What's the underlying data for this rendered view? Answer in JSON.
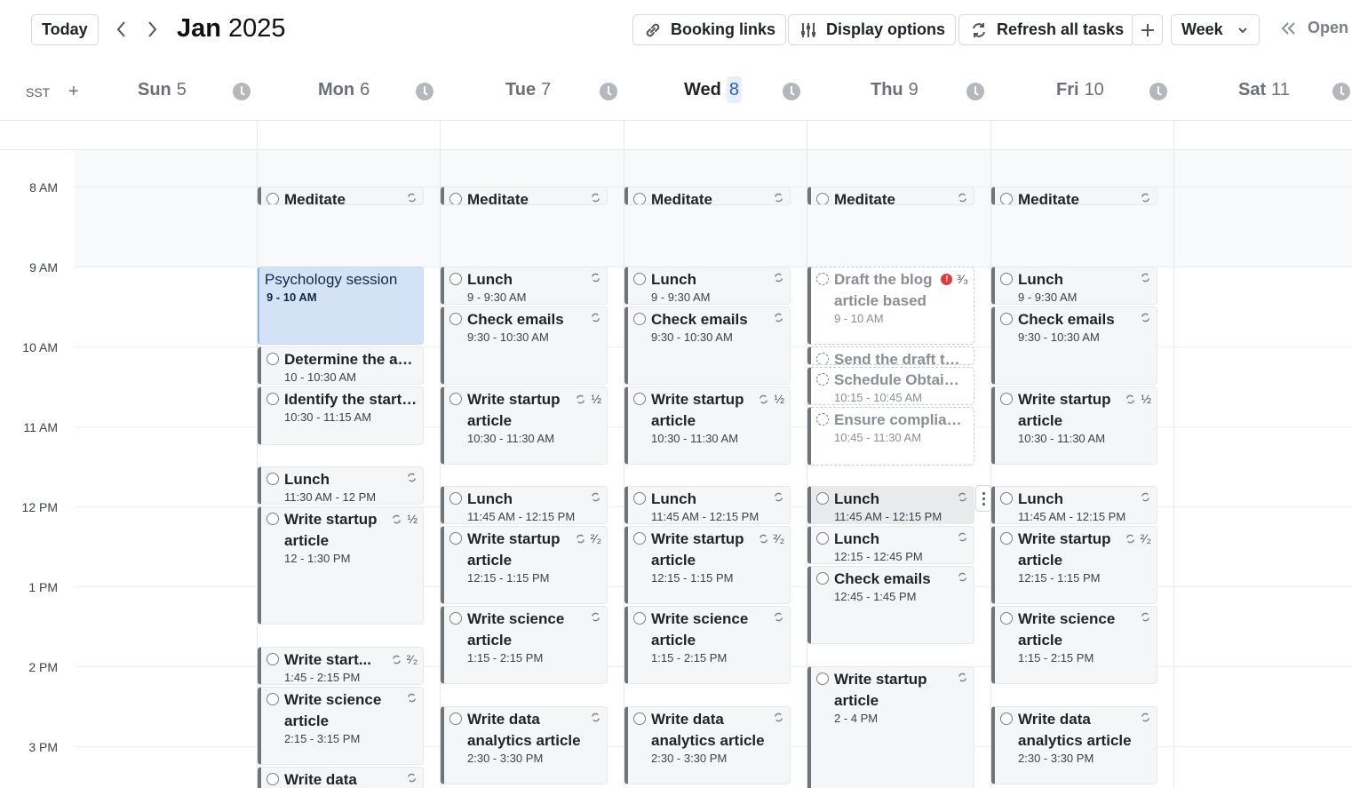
{
  "toolbar": {
    "today": "Today",
    "month": "Jan",
    "year": "2025",
    "booking_links": "Booking links",
    "display_options": "Display options",
    "refresh": "Refresh all tasks",
    "view": "Week",
    "open": "Open"
  },
  "timezone": "SST",
  "days": [
    {
      "name": "Sun",
      "num": "5"
    },
    {
      "name": "Mon",
      "num": "6"
    },
    {
      "name": "Tue",
      "num": "7"
    },
    {
      "name": "Wed",
      "num": "8"
    },
    {
      "name": "Thu",
      "num": "9"
    },
    {
      "name": "Fri",
      "num": "10"
    },
    {
      "name": "Sat",
      "num": "11"
    }
  ],
  "hours": [
    "8 AM",
    "9 AM",
    "10 AM",
    "11 AM",
    "12 PM",
    "1 PM",
    "2 PM",
    "3 PM"
  ],
  "events": {
    "mon": [
      {
        "title": "Meditate"
      },
      {
        "title": "Psychology session",
        "time": "9 - 10 AM"
      },
      {
        "title": "Determine the art...",
        "time": "10 - 10:30 AM"
      },
      {
        "title": "Identify the startu...",
        "time": "10:30 - 11:15 AM"
      },
      {
        "title": "Lunch",
        "time": "11:30 AM - 12 PM"
      },
      {
        "title": "Write startup article",
        "time": "12 - 1:30 PM",
        "frac": "½"
      },
      {
        "title": "Write start...",
        "time": "1:45 - 2:15 PM",
        "frac": "²⁄₂"
      },
      {
        "title": "Write science article",
        "time": "2:15 - 3:15 PM"
      },
      {
        "title": "Write data"
      }
    ],
    "tue": [
      {
        "title": "Meditate"
      },
      {
        "title": "Lunch",
        "time": "9 - 9:30 AM"
      },
      {
        "title": "Check emails",
        "time": "9:30 - 10:30 AM"
      },
      {
        "title": "Write startup article",
        "time": "10:30 - 11:30 AM",
        "frac": "½"
      },
      {
        "title": "Lunch",
        "time": "11:45 AM - 12:15 PM"
      },
      {
        "title": "Write startup article",
        "time": "12:15 - 1:15 PM",
        "frac": "²⁄₂"
      },
      {
        "title": "Write science article",
        "time": "1:15 - 2:15 PM"
      },
      {
        "title": "Write data analytics article",
        "time": "2:30 - 3:30 PM"
      }
    ],
    "wed": [
      {
        "title": "Meditate"
      },
      {
        "title": "Lunch",
        "time": "9 - 9:30 AM"
      },
      {
        "title": "Check emails",
        "time": "9:30 - 10:30 AM"
      },
      {
        "title": "Write startup article",
        "time": "10:30 - 11:30 AM",
        "frac": "½"
      },
      {
        "title": "Lunch",
        "time": "11:45 AM - 12:15 PM"
      },
      {
        "title": "Write startup article",
        "time": "12:15 - 1:15 PM",
        "frac": "²⁄₂"
      },
      {
        "title": "Write science article",
        "time": "1:15 - 2:15 PM"
      },
      {
        "title": "Write data analytics article",
        "time": "2:30 - 3:30 PM"
      }
    ],
    "thu": [
      {
        "title": "Meditate"
      },
      {
        "title": "Draft the blog article based on t...",
        "time": "9 - 10 AM",
        "frac": "³⁄₃"
      },
      {
        "title": "Send the draft to ..."
      },
      {
        "title": "Schedule Obtain f...",
        "time": "10:15 - 10:45 AM"
      },
      {
        "title": "Ensure complianc...",
        "time": "10:45 - 11:30 AM"
      },
      {
        "title": "Lunch",
        "time": "11:45 AM - 12:15 PM"
      },
      {
        "title": "Lunch",
        "time": "12:15 - 12:45 PM"
      },
      {
        "title": "Check emails",
        "time": "12:45 - 1:45 PM"
      },
      {
        "title": "Write startup article",
        "time": "2 - 4 PM"
      }
    ],
    "fri": [
      {
        "title": "Meditate"
      },
      {
        "title": "Lunch",
        "time": "9 - 9:30 AM"
      },
      {
        "title": "Check emails",
        "time": "9:30 - 10:30 AM"
      },
      {
        "title": "Write startup article",
        "time": "10:30 - 11:30 AM",
        "frac": "½"
      },
      {
        "title": "Lunch",
        "time": "11:45 AM - 12:15 PM"
      },
      {
        "title": "Write startup article",
        "time": "12:15 - 1:15 PM",
        "frac": "²⁄₂"
      },
      {
        "title": "Write science article",
        "time": "1:15 - 2:15 PM"
      },
      {
        "title": "Write data analytics article",
        "time": "2:30 - 3:30 PM"
      }
    ]
  }
}
